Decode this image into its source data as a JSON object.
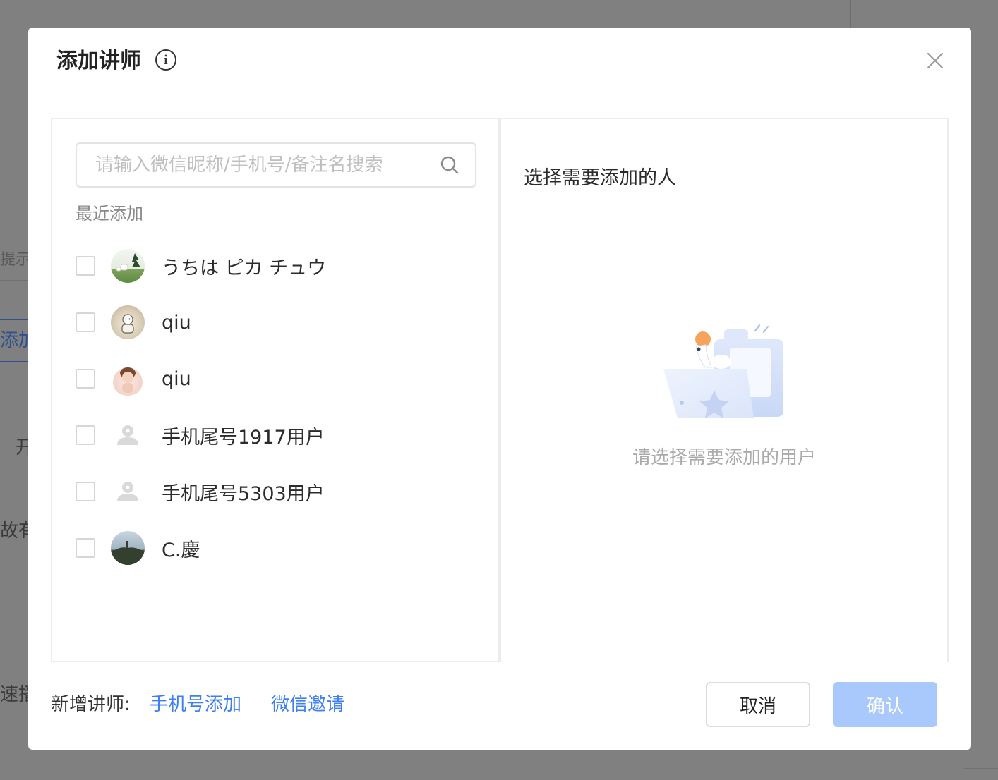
{
  "background": {
    "hint_text": "提示",
    "add_text": "添加",
    "fragment_1": "开",
    "fragment_2": "故有",
    "fragment_3": "速播"
  },
  "modal": {
    "title": "添加讲师",
    "info_icon_glyph": "i",
    "search": {
      "placeholder": "请输入微信昵称/手机号/备注名搜索"
    },
    "recent_label": "最近添加",
    "users": [
      {
        "name": "うちは ピカ チュウ",
        "avatar": "photo-avatar"
      },
      {
        "name": "qiu",
        "avatar": "photo-avatar"
      },
      {
        "name": "qiu",
        "avatar": "photo-avatar"
      },
      {
        "name": "手机尾号1917用户",
        "avatar": "default-user-icon"
      },
      {
        "name": "手机尾号5303用户",
        "avatar": "default-user-icon"
      },
      {
        "name": "C.慶",
        "avatar": "photo-avatar"
      }
    ],
    "right_title": "选择需要添加的人",
    "empty_text": "请选择需要添加的用户",
    "footer": {
      "label": "新增讲师:",
      "phone_add": "手机号添加",
      "wechat_invite": "微信邀请",
      "cancel": "取消",
      "confirm": "确认"
    }
  },
  "colors": {
    "link": "#3d7ef0",
    "confirm_disabled": "#a9c8fb",
    "overlay": "#808080"
  }
}
